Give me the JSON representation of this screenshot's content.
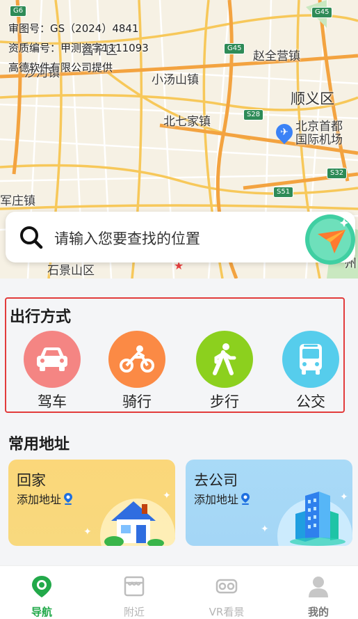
{
  "map": {
    "credits": [
      "审图号：GS（2024）4841",
      "资质编号：甲测资字1111093",
      "高德软件有限公司提供"
    ],
    "labels": {
      "changping": "昌平区",
      "shahe": "沙河镇",
      "xiaotangshan": "小汤山镇",
      "zhaoquanying": "赵全营镇",
      "shunyi": "顺义区",
      "beiqijia": "北七家镇",
      "airport": "北京首都\n国际机场",
      "junzhuang": "军庄镇",
      "shijingshan": "石景山区",
      "zhou": "州"
    },
    "shields": {
      "g6": "G6",
      "g45a": "G45",
      "g45b": "G45",
      "s28": "S28",
      "s32": "S32",
      "s51": "S51"
    }
  },
  "search": {
    "placeholder": "请输入您要查找的位置"
  },
  "travel": {
    "title": "出行方式",
    "modes": [
      {
        "label": "驾车",
        "color": "#f48583",
        "icon": "car-icon"
      },
      {
        "label": "骑行",
        "color": "#fb8a45",
        "icon": "motorbike-icon"
      },
      {
        "label": "步行",
        "color": "#8cd01e",
        "icon": "walk-icon"
      },
      {
        "label": "公交",
        "color": "#56cdec",
        "icon": "bus-icon"
      }
    ]
  },
  "common": {
    "title": "常用地址",
    "home": {
      "title": "回家",
      "sub": "添加地址"
    },
    "work": {
      "title": "去公司",
      "sub": "添加地址"
    }
  },
  "tabs": [
    {
      "label": "导航",
      "icon": "navigation-pin-icon"
    },
    {
      "label": "附近",
      "icon": "nearby-store-icon"
    },
    {
      "label": "VR看景",
      "icon": "vr-goggles-icon"
    },
    {
      "label": "我的",
      "icon": "profile-icon"
    }
  ],
  "colors": {
    "accent": "#22a94a",
    "highlight_border": "#e23b3b",
    "home_card": "#fbd77a",
    "work_card": "#a9daf7"
  }
}
